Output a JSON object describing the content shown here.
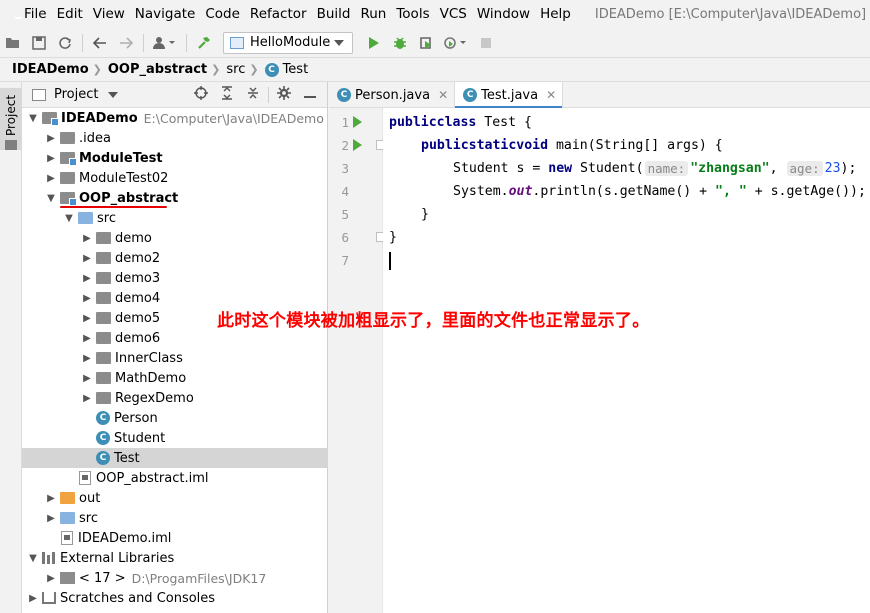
{
  "menu": {
    "items": [
      "File",
      "Edit",
      "View",
      "Navigate",
      "Code",
      "Refactor",
      "Build",
      "Run",
      "Tools",
      "VCS",
      "Window",
      "Help"
    ],
    "window_title": "IDEADemo [E:\\Computer\\Java\\IDEADemo] - Tes"
  },
  "toolbar": {
    "run_config": "HelloModule"
  },
  "breadcrumb": {
    "items": [
      "IDEADemo",
      "OOP_abstract",
      "src",
      "Test"
    ]
  },
  "left_stripe": {
    "label": "Project"
  },
  "project_panel": {
    "title": "Project",
    "tree": [
      {
        "name": "IDEADemo",
        "path": "E:\\Computer\\Java\\IDEADemo"
      },
      {
        "name": ".idea"
      },
      {
        "name": "ModuleTest"
      },
      {
        "name": "ModuleTest02"
      },
      {
        "name": "OOP_abstract"
      },
      {
        "name": "src"
      },
      {
        "name": "demo"
      },
      {
        "name": "demo2"
      },
      {
        "name": "demo3"
      },
      {
        "name": "demo4"
      },
      {
        "name": "demo5"
      },
      {
        "name": "demo6"
      },
      {
        "name": "InnerClass"
      },
      {
        "name": "MathDemo"
      },
      {
        "name": "RegexDemo"
      },
      {
        "name": "Person"
      },
      {
        "name": "Student"
      },
      {
        "name": "Test"
      },
      {
        "name": "OOP_abstract.iml"
      },
      {
        "name": "out"
      },
      {
        "name": "src"
      },
      {
        "name": "IDEADemo.iml"
      },
      {
        "name": "External Libraries"
      },
      {
        "name": "< 17 >",
        "path": "D:\\ProgamFiles\\JDK17"
      },
      {
        "name": "Scratches and Consoles"
      }
    ]
  },
  "editor": {
    "tabs": [
      "Person.java",
      "Test.java"
    ],
    "line_numbers": [
      "1",
      "2",
      "3",
      "4",
      "5",
      "6",
      "7"
    ],
    "code": {
      "l1_kw1": "public",
      "l1_kw2": "class",
      "l1_rest": " Test {",
      "l2_kw1": "public",
      "l2_kw2": "static",
      "l2_kw3": "void",
      "l2_rest": " main(String[] args) {",
      "l3_a": "Student s = ",
      "l3_new": "new",
      "l3_b": " Student(",
      "l3_hint1": "name:",
      "l3_str": "\"zhangsan\"",
      "l3_c": ", ",
      "l3_hint2": "age:",
      "l3_num": "23",
      "l3_d": ");",
      "l4_a": "System.",
      "l4_out": "out",
      "l4_b": ".println(s.getName() + ",
      "l4_str": "\", \"",
      "l4_c": " + s.getAge());",
      "l5": "}",
      "l6": "}"
    }
  },
  "annotation": "此时这个模块被加粗显示了，里面的文件也正常显示了。"
}
